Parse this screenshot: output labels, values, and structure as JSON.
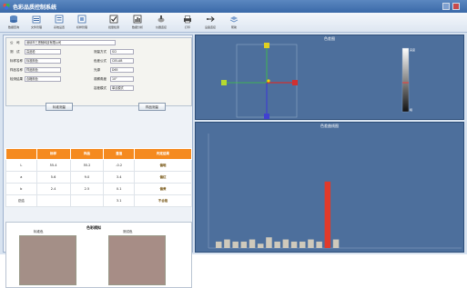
{
  "app": {
    "title": "色彩品质控制系统"
  },
  "toolbar": [
    {
      "label": "数据查询",
      "icon": "database-icon"
    },
    {
      "label": "文件管理",
      "icon": "folder-icon"
    },
    {
      "label": "系统设置",
      "icon": "settings-icon"
    },
    {
      "label": "标样管理",
      "icon": "standard-icon"
    },
    {
      "label": "批量检测",
      "icon": "checklist-icon"
    },
    {
      "label": "数据分析",
      "icon": "chart-icon"
    },
    {
      "label": "仪器连接",
      "icon": "instrument-icon"
    },
    {
      "label": "打印",
      "icon": "printer-icon"
    },
    {
      "label": "设备连接",
      "icon": "usb-icon"
    },
    {
      "label": "帮助",
      "icon": "help-icon"
    }
  ],
  "form": {
    "company_label": "公　司",
    "company_value": "深圳市三恩驰科技有限公司",
    "operator_label": "测　试",
    "operator_value": "高品检",
    "std_name_label": "标样名称",
    "std_name_value": "标准颜色",
    "sample_name_label": "样品名称",
    "sample_name_value": "样品颜色",
    "result_label": "检测结果",
    "result_value": "合格颜色",
    "method_label": "测量方式",
    "method_value": "SCI",
    "formula_label": "色差公式",
    "formula_value": "CIELAB",
    "illuminant_label": "光源",
    "illuminant_value": "D65",
    "observer_label": "观察角度",
    "observer_value": "10°",
    "tolerance_label": "容差模式",
    "tolerance_value": "单点模式",
    "std_button": "标准测量",
    "sample_button": "样品测量"
  },
  "table": {
    "headers": [
      "",
      "标样",
      "样品",
      "差值",
      "判定结果"
    ],
    "rows": [
      [
        "L",
        "55.4",
        "55.2",
        "-0.2",
        "偏暗"
      ],
      [
        "a",
        "5.6",
        "9.0",
        "3.4",
        "偏红"
      ],
      [
        "b",
        "2.4",
        "2.5",
        "0.1",
        "偏黄"
      ],
      [
        "总结",
        "",
        "",
        "3.1",
        "不合格"
      ]
    ]
  },
  "colors": {
    "title": "色彩模拟",
    "std_label": "标准色",
    "sample_label": "测试色",
    "std_hex": "#a48f87",
    "sample_hex": "#a78d86"
  },
  "panels": {
    "top_title": "色差图",
    "bottom_title": "色差曲线图",
    "scale_labels": [
      "亮度",
      "暗"
    ]
  },
  "chart_data": {
    "type": "bar",
    "title": "色差曲线图",
    "categories": [
      "1",
      "2",
      "3",
      "4",
      "5",
      "6",
      "7",
      "8",
      "9",
      "10",
      "11",
      "12",
      "13",
      "14",
      "15"
    ],
    "values": [
      0.3,
      0.4,
      0.3,
      0.3,
      0.4,
      0.2,
      0.5,
      0.3,
      0.4,
      0.3,
      0.3,
      0.4,
      0.3,
      3.1,
      0.4
    ],
    "highlight_index": 13,
    "bar_color": "#cfc9bb",
    "highlight_color": "#e03a2a",
    "ylim": [
      0,
      5
    ]
  }
}
